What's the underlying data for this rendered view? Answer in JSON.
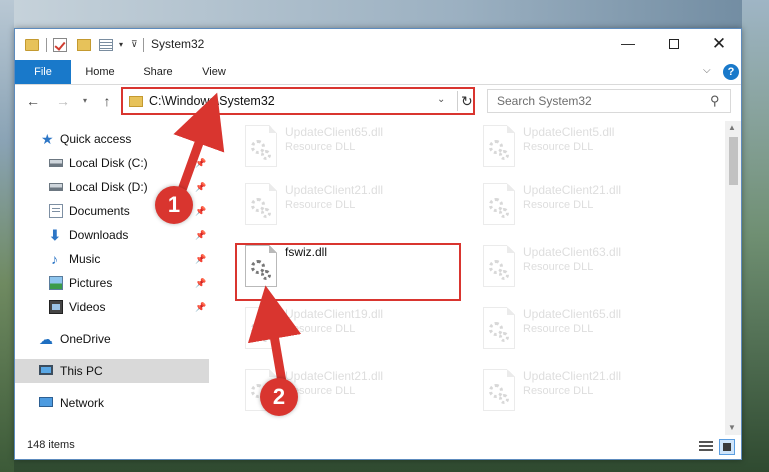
{
  "window": {
    "title": "System32",
    "controls": {
      "minimize": "—",
      "maximize": "",
      "close": "✕"
    }
  },
  "quick_access_toolbar": {
    "dropdown_glyph": "▾",
    "customize_glyph": "⊽"
  },
  "ribbon": {
    "tabs": [
      "File",
      "Home",
      "Share",
      "View"
    ],
    "collapse_glyph": "⌵",
    "help_glyph": "?"
  },
  "address_bar": {
    "path": "C:\\Windows\\System32",
    "dropdown_glyph": "⌄",
    "refresh_glyph": "↻"
  },
  "nav_buttons": {
    "back": "←",
    "forward": "→",
    "recent": "▾",
    "up": "↑"
  },
  "search": {
    "placeholder": "Search System32",
    "icon_glyph": "⚲"
  },
  "nav_pane": {
    "items": [
      {
        "label": "Quick access",
        "icon": "star-icon",
        "glyph": "★",
        "pinned": false,
        "selected": false
      },
      {
        "label": "Local Disk (C:)",
        "icon": "disk-icon",
        "glyph": "",
        "pinned": true,
        "selected": false
      },
      {
        "label": "Local Disk (D:)",
        "icon": "disk-icon",
        "glyph": "",
        "pinned": true,
        "selected": false
      },
      {
        "label": "Documents",
        "icon": "documents-icon",
        "glyph": "",
        "pinned": true,
        "selected": false
      },
      {
        "label": "Downloads",
        "icon": "download-icon",
        "glyph": "⬇",
        "pinned": true,
        "selected": false
      },
      {
        "label": "Music",
        "icon": "music-icon",
        "glyph": "♪",
        "pinned": true,
        "selected": false
      },
      {
        "label": "Pictures",
        "icon": "pictures-icon",
        "glyph": "",
        "pinned": true,
        "selected": false
      },
      {
        "label": "Videos",
        "icon": "videos-icon",
        "glyph": "",
        "pinned": true,
        "selected": false
      },
      {
        "label": "OneDrive",
        "icon": "cloud-icon",
        "glyph": "☁",
        "pinned": false,
        "selected": false
      },
      {
        "label": "This PC",
        "icon": "computer-icon",
        "glyph": "",
        "pinned": false,
        "selected": true
      },
      {
        "label": "Network",
        "icon": "network-icon",
        "glyph": "",
        "pinned": false,
        "selected": false
      }
    ],
    "pin_glyph": "📌"
  },
  "files": [
    {
      "name": "UpdateClient65.dll",
      "type": "Resource DLL",
      "faded": true
    },
    {
      "name": "UpdateClient5.dll",
      "type": "Resource DLL",
      "faded": true
    },
    {
      "name": "UpdateClient21.dll",
      "type": "Resource DLL",
      "faded": true
    },
    {
      "name": "UpdateClient21.dll",
      "type": "Resource DLL",
      "faded": true
    },
    {
      "name": "fswiz.dll",
      "type": "",
      "faded": false,
      "highlighted": true
    },
    {
      "name": "UpdateClient63.dll",
      "type": "Resource DLL",
      "faded": true
    },
    {
      "name": "UpdateClient19.dll",
      "type": "Resource DLL",
      "faded": true
    },
    {
      "name": "UpdateClient65.dll",
      "type": "Resource DLL",
      "faded": true
    },
    {
      "name": "UpdateClient21.dll",
      "type": "Resource DLL",
      "faded": true
    },
    {
      "name": "UpdateClient21.dll",
      "type": "Resource DLL",
      "faded": true
    }
  ],
  "status_bar": {
    "item_count": "148 items"
  },
  "annotations": [
    {
      "number": "1",
      "color": "#d9352f"
    },
    {
      "number": "2",
      "color": "#d9352f"
    }
  ],
  "colors": {
    "accent": "#1979ca",
    "highlight_red": "#d9352f",
    "selection_gray": "#d9d9d9"
  }
}
